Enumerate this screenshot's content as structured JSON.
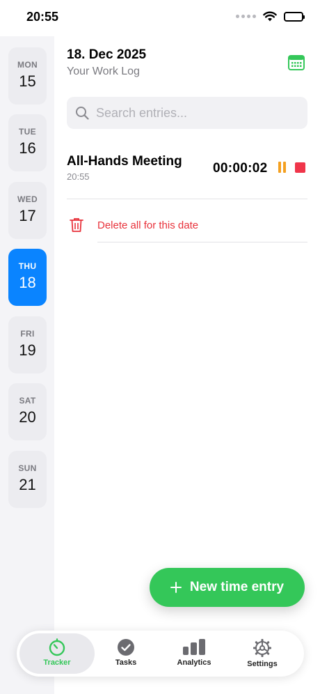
{
  "status_bar": {
    "time": "20:55"
  },
  "sidebar": {
    "days": [
      {
        "dow": "MON",
        "dom": "15",
        "active": false
      },
      {
        "dow": "TUE",
        "dom": "16",
        "active": false
      },
      {
        "dow": "WED",
        "dom": "17",
        "active": false
      },
      {
        "dow": "THU",
        "dom": "18",
        "active": true
      },
      {
        "dow": "FRI",
        "dom": "19",
        "active": false
      },
      {
        "dow": "SAT",
        "dom": "20",
        "active": false
      },
      {
        "dow": "SUN",
        "dom": "21",
        "active": false
      }
    ]
  },
  "header": {
    "date": "18. Dec 2025",
    "subtitle": "Your Work Log",
    "calendar_icon": "calendar-icon"
  },
  "search": {
    "placeholder": "Search entries...",
    "value": ""
  },
  "entries": [
    {
      "title": "All-Hands Meeting",
      "time": "20:55",
      "timer": "00:00:02"
    }
  ],
  "delete_all": {
    "label": "Delete all for this date"
  },
  "fab": {
    "label": "New time entry"
  },
  "tab_bar": {
    "tabs": [
      {
        "label": "Tracker",
        "icon": "stopwatch-icon",
        "active": true
      },
      {
        "label": "Tasks",
        "icon": "checkmark-circle-icon",
        "active": false
      },
      {
        "label": "Analytics",
        "icon": "bar-chart-icon",
        "active": false
      },
      {
        "label": "Settings",
        "icon": "gear-icon",
        "active": false
      }
    ]
  },
  "colors": {
    "accent_blue": "#0a84ff",
    "accent_green": "#34c759",
    "danger_red": "#e8313a",
    "pause_orange": "#f4a020"
  }
}
